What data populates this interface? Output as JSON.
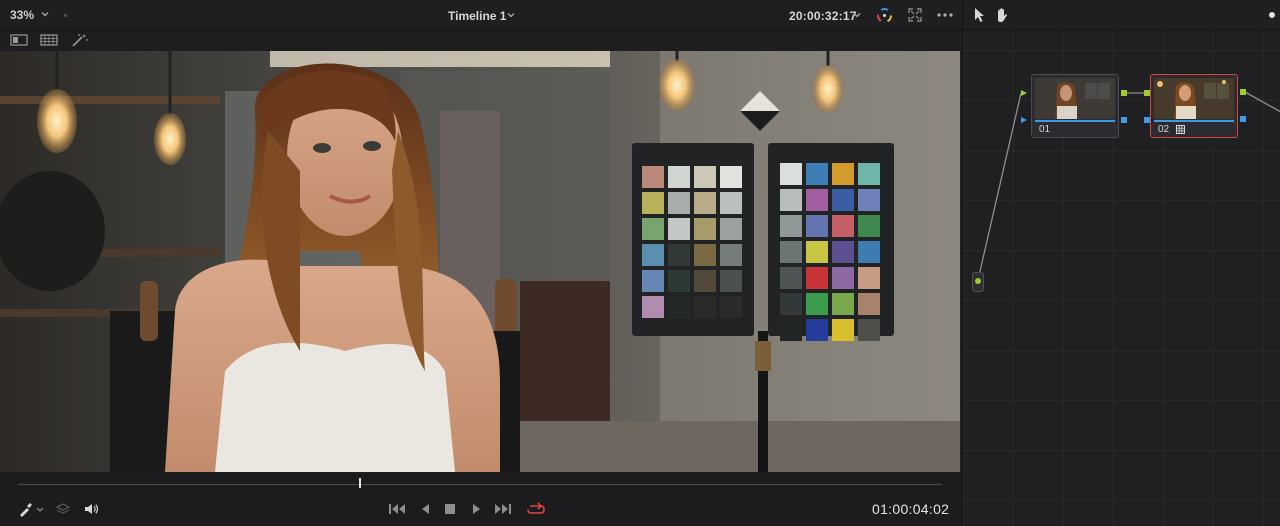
{
  "viewer": {
    "zoom": "33%",
    "timeline_name": "Timeline 1",
    "timecode_top": "20:00:32:17",
    "timecode_bottom": "01:00:04:02",
    "playhead_fraction": 0.37
  },
  "icons": {
    "viewer_toolbar": [
      "zoom-chevron-icon",
      "color-wheel-icon",
      "expand-icon",
      "more-icon"
    ],
    "subbar": [
      "split-view-icon",
      "grid-view-icon",
      "magic-wand-icon"
    ],
    "transport": [
      "eyedropper-icon",
      "layers-icon",
      "speaker-icon",
      "skip-start-icon",
      "step-back-icon",
      "stop-icon",
      "play-icon",
      "skip-end-icon",
      "loop-icon"
    ],
    "node_toolbar": [
      "pointer-icon",
      "hand-icon"
    ]
  },
  "nodes": [
    {
      "label": "01",
      "selected": false
    },
    {
      "label": "02",
      "selected": true
    }
  ],
  "colors": {
    "accent_red": "#d2453f",
    "link_blue": "#3d9be8",
    "port_green": "#9fcc2e",
    "loop_active": "#e2453c"
  }
}
